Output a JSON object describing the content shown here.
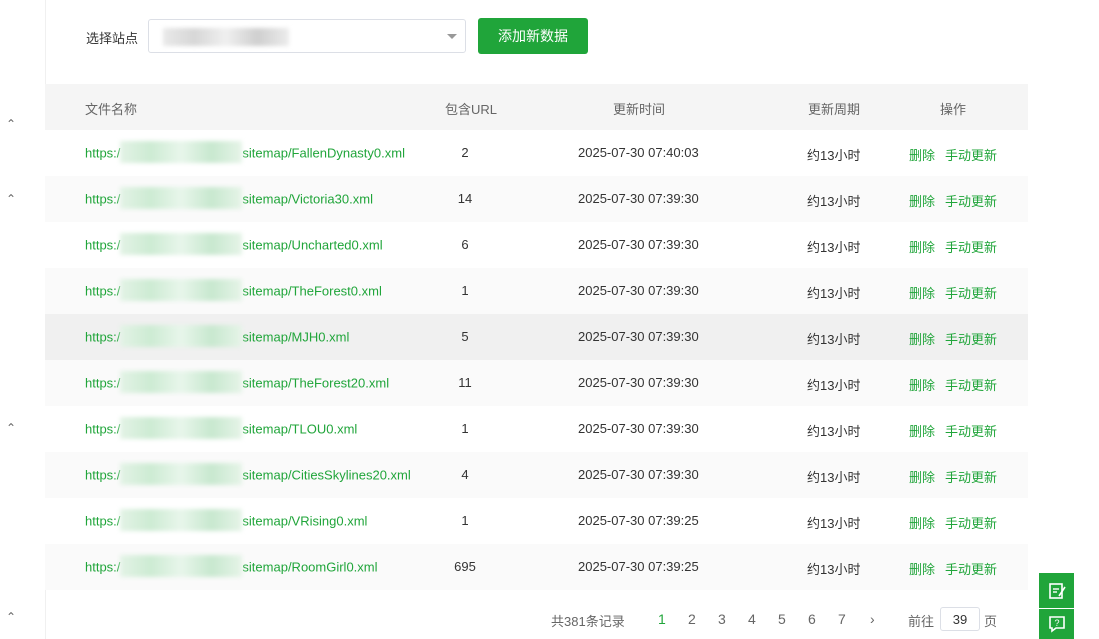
{
  "toolbar": {
    "site_label": "选择站点",
    "add_button": "添加新数据"
  },
  "table": {
    "headers": {
      "file_name": "文件名称",
      "url_count": "包含URL",
      "update_time": "更新时间",
      "update_period": "更新周期",
      "actions": "操作"
    },
    "rows": [
      {
        "url_prefix": "https:/",
        "file": "sitemap/FallenDynasty0.xml",
        "count": "2",
        "time": "2025-07-30 07:40:03",
        "period": "约13小时"
      },
      {
        "url_prefix": "https:/",
        "file": "sitemap/Victoria30.xml",
        "count": "14",
        "time": "2025-07-30 07:39:30",
        "period": "约13小时"
      },
      {
        "url_prefix": "https:/",
        "file": "sitemap/Uncharted0.xml",
        "count": "6",
        "time": "2025-07-30 07:39:30",
        "period": "约13小时"
      },
      {
        "url_prefix": "https:/",
        "file": "sitemap/TheForest0.xml",
        "count": "1",
        "time": "2025-07-30 07:39:30",
        "period": "约13小时"
      },
      {
        "url_prefix": "https:/",
        "file": "sitemap/MJH0.xml",
        "count": "5",
        "time": "2025-07-30 07:39:30",
        "period": "约13小时"
      },
      {
        "url_prefix": "https:/",
        "file": "sitemap/TheForest20.xml",
        "count": "11",
        "time": "2025-07-30 07:39:30",
        "period": "约13小时"
      },
      {
        "url_prefix": "https:/",
        "file": "sitemap/TLOU0.xml",
        "count": "1",
        "time": "2025-07-30 07:39:30",
        "period": "约13小时"
      },
      {
        "url_prefix": "https:/",
        "file": "sitemap/CitiesSkylines20.xml",
        "count": "4",
        "time": "2025-07-30 07:39:30",
        "period": "约13小时"
      },
      {
        "url_prefix": "https:/",
        "file": "sitemap/VRising0.xml",
        "count": "1",
        "time": "2025-07-30 07:39:25",
        "period": "约13小时"
      },
      {
        "url_prefix": "https:/",
        "file": "sitemap/RoomGirl0.xml",
        "count": "695",
        "time": "2025-07-30 07:39:25",
        "period": "约13小时"
      }
    ],
    "action_delete": "删除",
    "action_update": "手动更新"
  },
  "pagination": {
    "total": "共381条记录",
    "pages": [
      "1",
      "2",
      "3",
      "4",
      "5",
      "6",
      "7"
    ],
    "current": "1",
    "next": "›",
    "goto_label": "前往",
    "goto_value": "39",
    "page_suffix": "页"
  },
  "colors": {
    "accent": "#20a53a"
  }
}
